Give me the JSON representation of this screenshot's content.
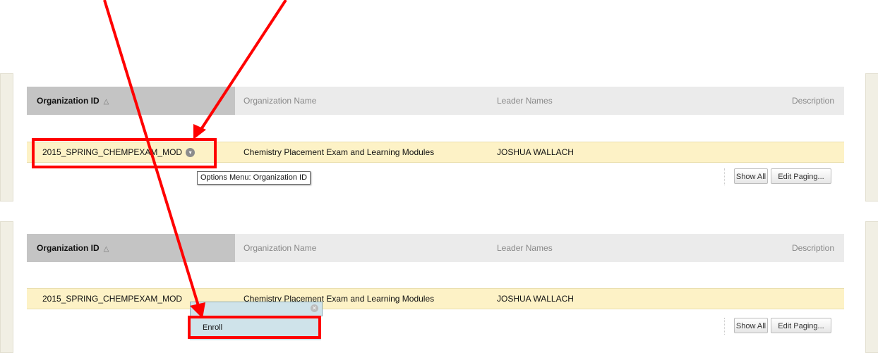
{
  "table": {
    "col_id": "Organization ID",
    "col_name": "Organization Name",
    "col_leader": "Leader Names",
    "col_desc": "Description",
    "sort_icon": "triangle-up-icon"
  },
  "row": {
    "id": "2015_SPRING_CHEMPEXAM_MOD",
    "name": "Chemistry Placement Exam and Learning Modules",
    "leader": "JOSHUA WALLACH"
  },
  "tooltip": "Options Menu: Organization ID",
  "pager": {
    "show_all": "Show All",
    "edit_paging": "Edit Paging..."
  },
  "menu": {
    "enroll": "Enroll",
    "close_icon": "close-icon"
  },
  "colors": {
    "annotation": "#ff0000",
    "row_highlight": "#fdf2c6",
    "menu_bg": "#cfe3ea",
    "sorted_header": "#c4c4c4"
  }
}
